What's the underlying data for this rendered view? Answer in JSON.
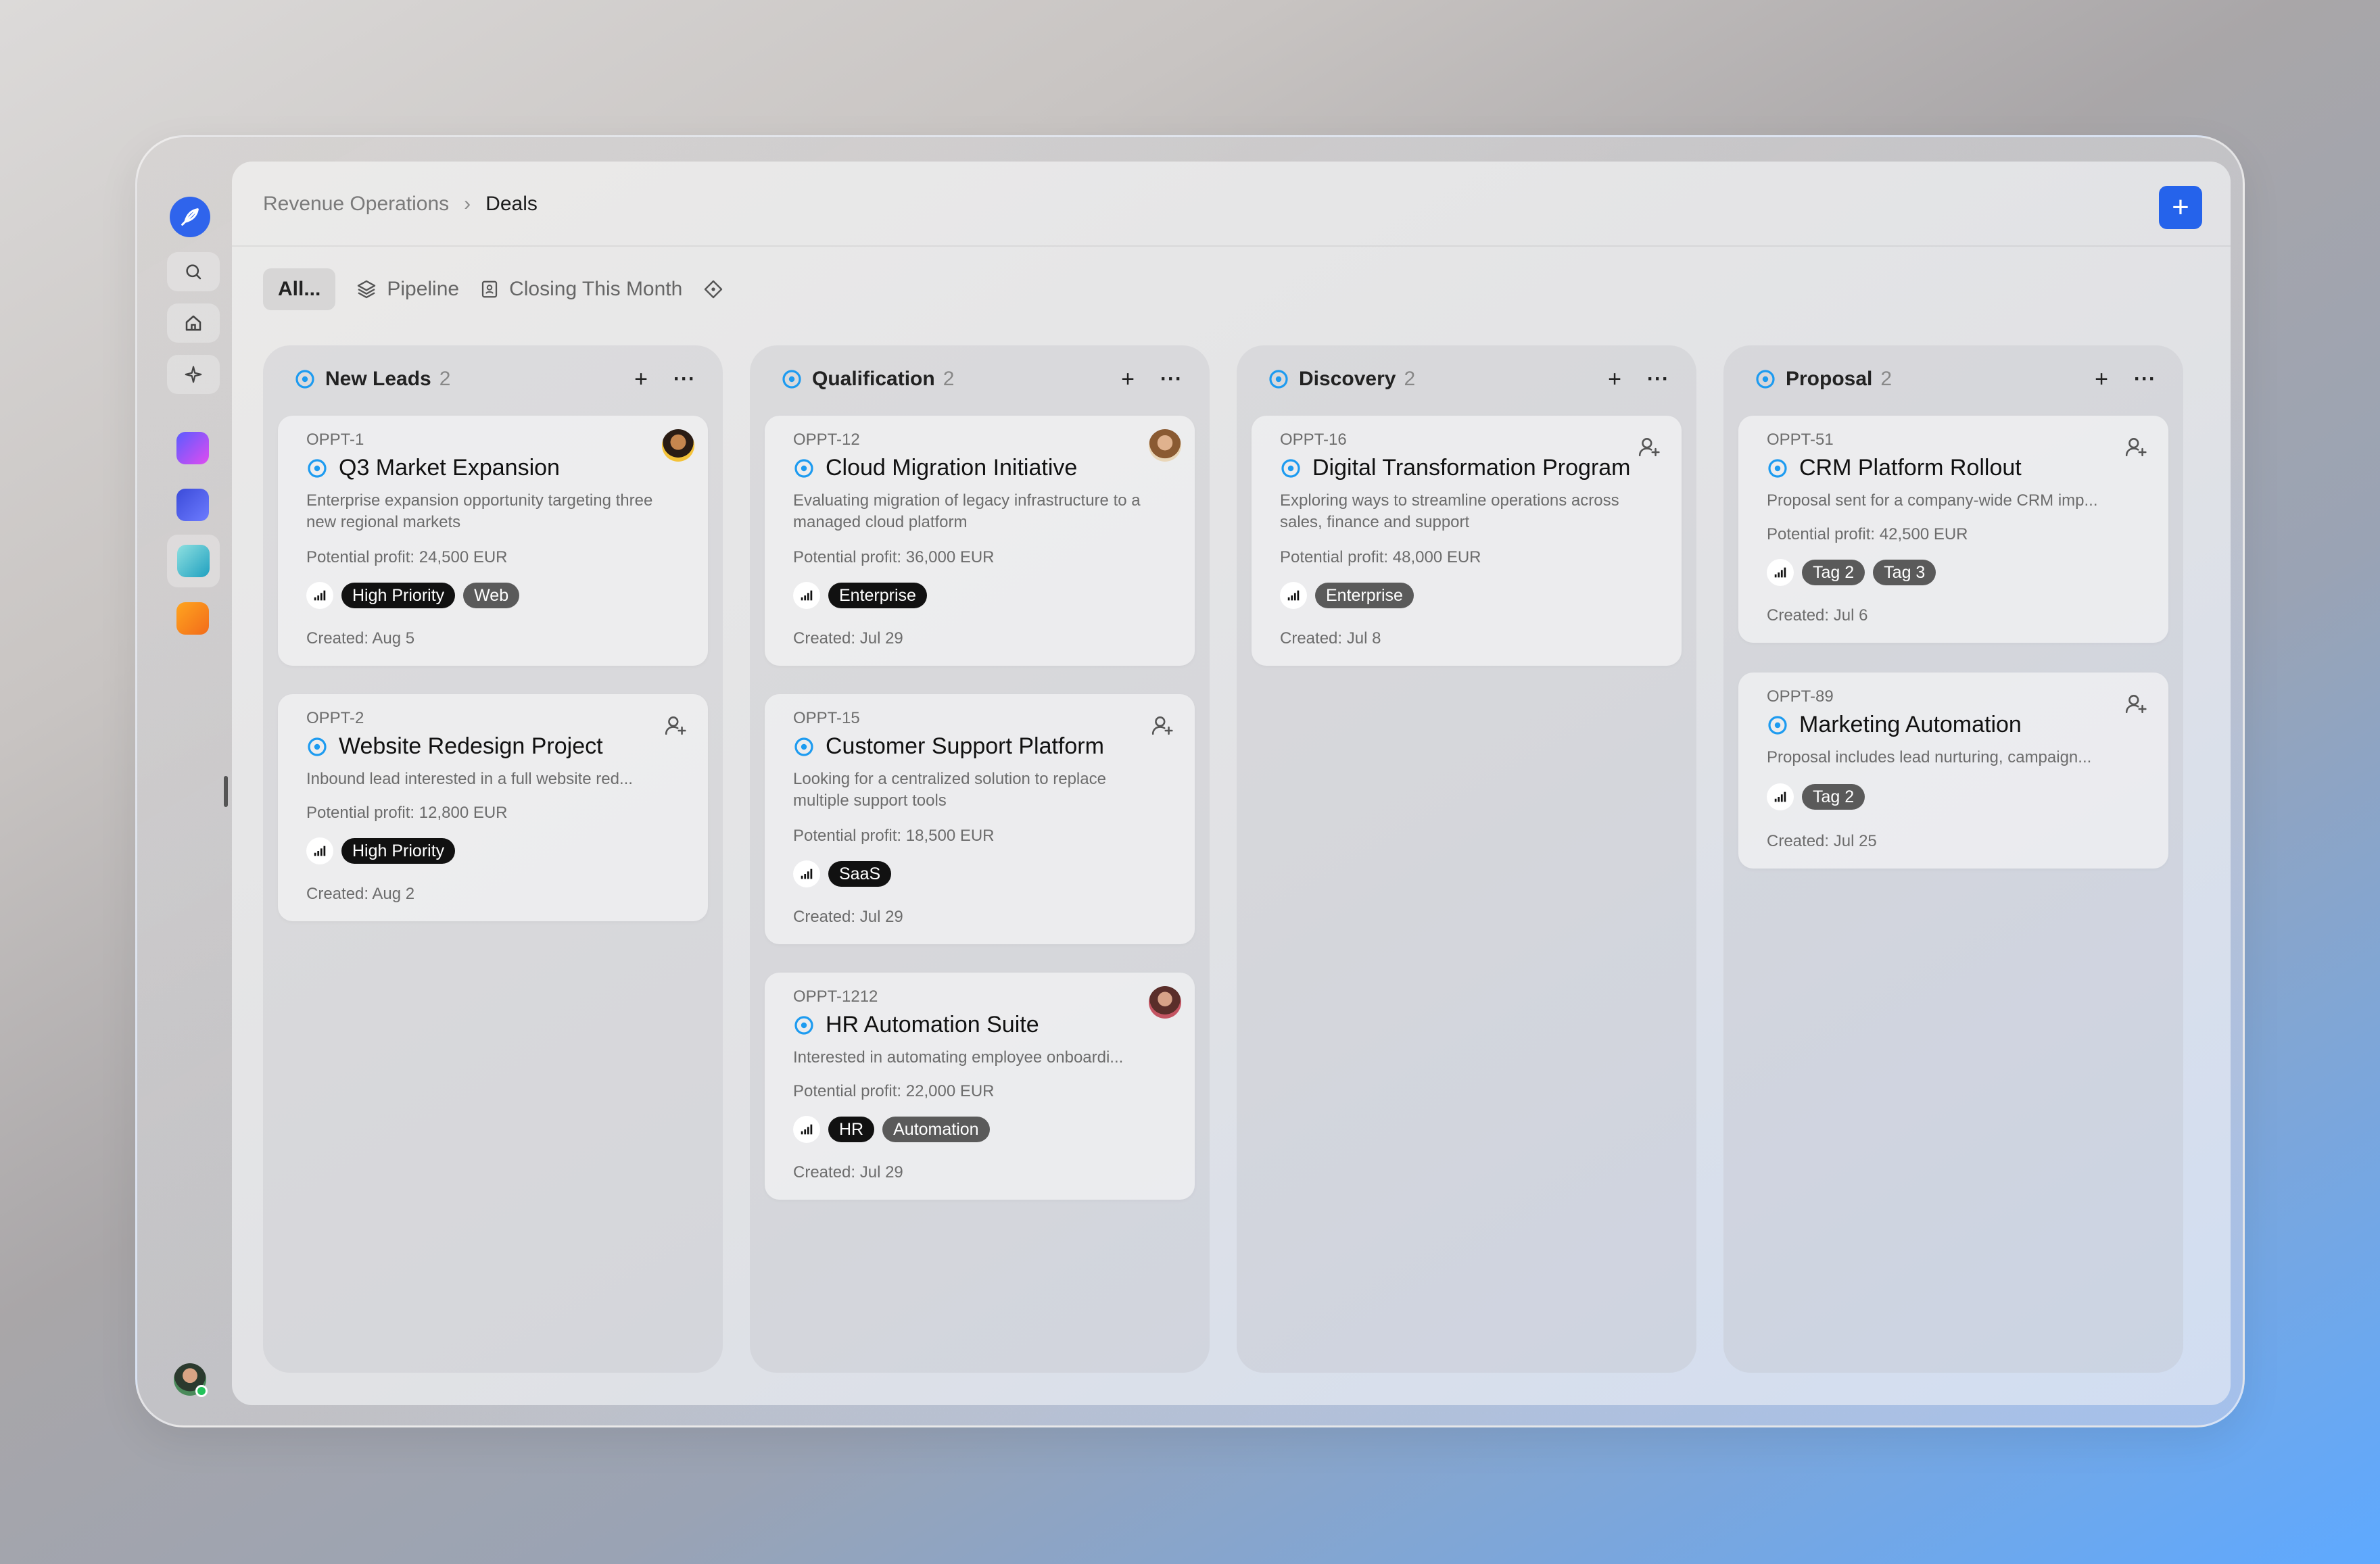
{
  "breadcrumb": {
    "parent": "Revenue Operations",
    "separator": "›",
    "current": "Deals"
  },
  "header": {
    "add_label": "+"
  },
  "views": {
    "all_label": "All...",
    "pipeline_label": "Pipeline",
    "closing_label": "Closing This Month"
  },
  "colors": {
    "accent": "#2563eb",
    "status_ring": "#1d9bf0",
    "tag_dark": "#111111",
    "tag_grey": "#5a5a5a"
  },
  "icons": {
    "logo": "feather-logo-icon",
    "search": "search-icon",
    "home": "home-icon",
    "ai": "sparkle-icon",
    "pipeline": "layers-icon",
    "closing": "calendar-user-icon",
    "more_views": "diamond-icon"
  },
  "column_actions": {
    "add": "+",
    "more": "···"
  },
  "columns": [
    {
      "title": "New Leads",
      "count": "2",
      "cards": [
        {
          "id": "OPPT-1",
          "title": "Q3 Market Expansion",
          "desc": "Enterprise expansion opportunity targeting three new regional markets",
          "profit": "Potential profit: 24,500 EUR",
          "tags": [
            "High Priority",
            "Web"
          ],
          "created": "Created: Aug 5"
        },
        {
          "id": "OPPT-2",
          "title": "Website Redesign Project",
          "desc": "Inbound lead interested in a full website red...",
          "profit": "Potential profit: 12,800 EUR",
          "tags": [
            "High Priority"
          ],
          "created": "Created: Aug 2"
        }
      ]
    },
    {
      "title": "Qualification",
      "count": "2",
      "cards": [
        {
          "id": "OPPT-12",
          "title": "Cloud Migration Initiative",
          "desc": "Evaluating migration of legacy infrastructure to a managed cloud platform",
          "profit": "Potential profit: 36,000 EUR",
          "tags": [
            "Enterprise"
          ],
          "created": "Created: Jul 29"
        },
        {
          "id": "OPPT-15",
          "title": "Customer Support Platform",
          "desc": "Looking for a centralized solution to replace multiple support tools",
          "profit": "Potential profit: 18,500 EUR",
          "tags": [
            "SaaS"
          ],
          "created": "Created: Jul 29"
        },
        {
          "id": "OPPT-1212",
          "title": "HR Automation Suite",
          "desc": "Interested in automating employee onboardi...",
          "profit": "Potential profit: 22,000 EUR",
          "tags": [
            "HR",
            "Automation"
          ],
          "created": "Created: Jul 29"
        }
      ]
    },
    {
      "title": "Discovery",
      "count": "2",
      "cards": [
        {
          "id": "OPPT-16",
          "title": "Digital Transformation Program",
          "desc": "Exploring ways to streamline operations across sales, finance and support",
          "profit": "Potential profit: 48,000 EUR",
          "tags": [
            "Enterprise"
          ],
          "created": "Created: Jul 8"
        }
      ]
    },
    {
      "title": "Proposal",
      "count": "2",
      "cards": [
        {
          "id": "OPPT-51",
          "title": "CRM Platform Rollout",
          "desc": "Proposal sent for a company-wide CRM imp...",
          "profit": "Potential profit: 42,500 EUR",
          "tags": [
            "Tag 2",
            "Tag 3"
          ],
          "created": "Created: Jul 6"
        },
        {
          "id": "OPPT-89",
          "title": "Marketing Automation",
          "desc": "Proposal includes lead nurturing, campaign...",
          "tags": [
            "Tag 2"
          ],
          "created": "Created: Jul 25"
        }
      ]
    }
  ]
}
